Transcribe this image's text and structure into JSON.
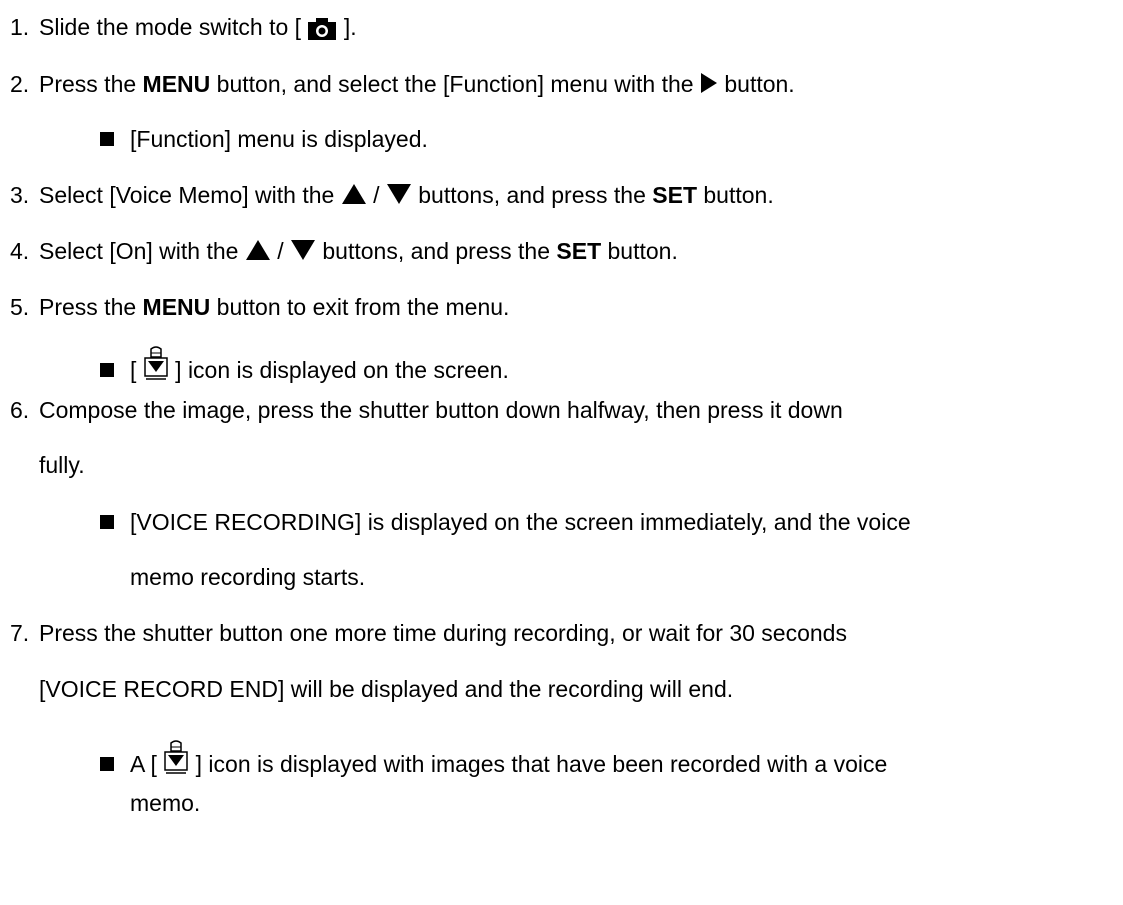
{
  "steps": [
    {
      "num": "1.",
      "a": "Slide the mode switch to [ ",
      "b": " ]."
    },
    {
      "num": "2.",
      "a": "Press the ",
      "bold1": "MENU",
      "b": " button, and select the [Function] menu with the ",
      "c": " button."
    },
    {
      "num": "3.",
      "a": "Select [Voice Memo] with the ",
      "sep": " / ",
      "b": " buttons, and press the ",
      "bold1": "SET",
      "c": " button."
    },
    {
      "num": "4.",
      "a": "Select [On] with the ",
      "sep": " / ",
      "b": " buttons, and press the ",
      "bold1": "SET",
      "c": " button."
    },
    {
      "num": "5.",
      "a": "Press the ",
      "bold1": "MENU",
      "b": " button to exit from the menu."
    },
    {
      "num": "6.",
      "line1": "Compose the image, press the shutter button down halfway, then press it down",
      "line2": "fully."
    },
    {
      "num": "7.",
      "line1": "Press the shutter button one more time during recording, or wait for 30 seconds",
      "line2": "[VOICE RECORD END] will be displayed and the recording will end."
    }
  ],
  "bullets": {
    "b2": "[Function] menu is displayed.",
    "b5_pre": "[ ",
    "b5_post": " ] icon is displayed on the screen.",
    "b6_line1": "[VOICE RECORDING] is displayed on the screen immediately, and the voice",
    "b6_line2": "memo recording starts.",
    "b7_pre": "A [ ",
    "b7_post": " ] icon is displayed with images that have been recorded with a voice",
    "b7_line2": "memo."
  },
  "icons": {
    "camera": "camera-icon",
    "right_arrow": "right-triangle-icon",
    "up_arrow": "up-triangle-icon",
    "down_arrow": "down-triangle-icon",
    "voice_memo": "voice-memo-icon"
  }
}
